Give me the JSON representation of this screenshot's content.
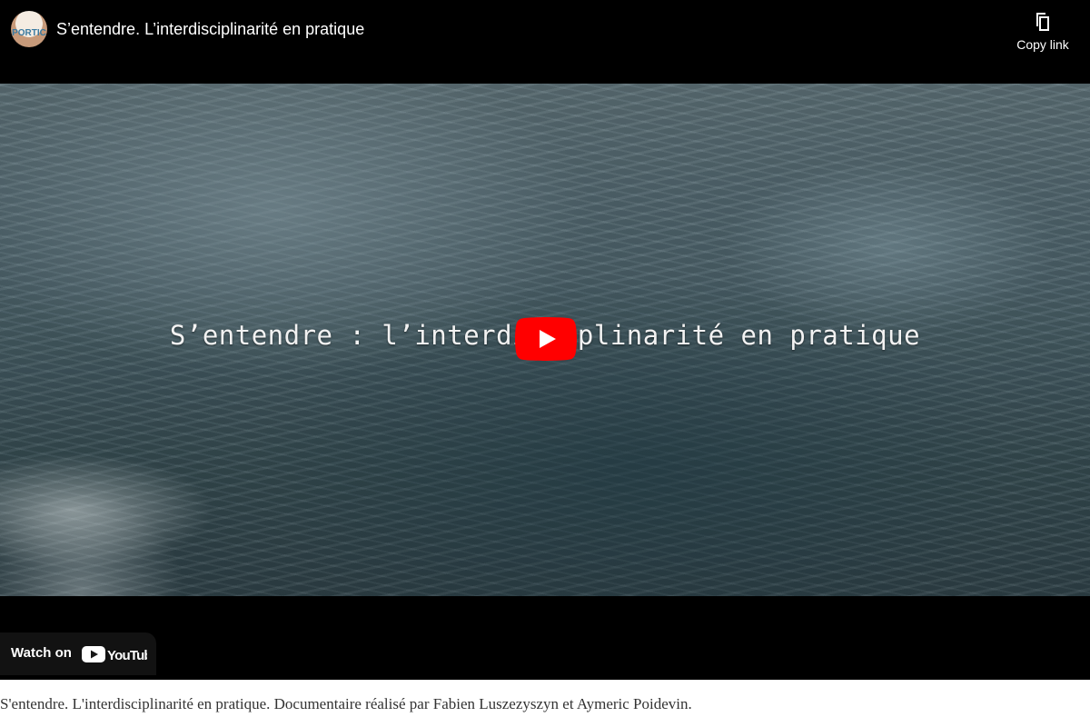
{
  "header": {
    "channel_logo_text": "PORTIC",
    "title": "S’entendre. L’interdisciplinarité en pratique",
    "copy_link_label": "Copy link"
  },
  "video": {
    "overlay_text": "S’entendre : l’interdisciplinarité en pratique"
  },
  "footer": {
    "watch_on_label": "Watch on",
    "youtube_wordmark": "YouTube"
  },
  "caption": "S'entendre. L'interdisciplinarité en pratique. Documentaire réalisé par Fabien Luszezyszyn et Aymeric Poidevin.",
  "colors": {
    "play_button": "#ff0000",
    "player_background": "#000000"
  }
}
